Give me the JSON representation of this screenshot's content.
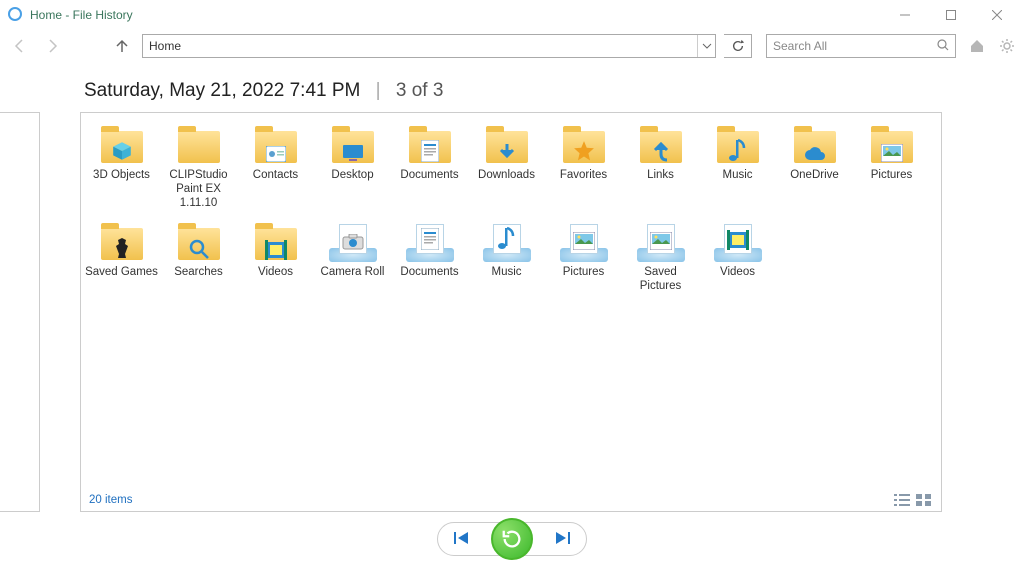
{
  "window": {
    "title": "Home - File History"
  },
  "nav": {
    "path": "Home",
    "search_placeholder": "Search All"
  },
  "header": {
    "timestamp": "Saturday, May 21, 2022 7:41 PM",
    "position": "3 of 3"
  },
  "items": [
    {
      "name": "3D Objects",
      "type": "folder",
      "overlay": "cube"
    },
    {
      "name": "CLIPStudio Paint EX 1.11.10",
      "type": "folder"
    },
    {
      "name": "Contacts",
      "type": "folder",
      "overlay": "card"
    },
    {
      "name": "Desktop",
      "type": "folder",
      "overlay": "desktop"
    },
    {
      "name": "Documents",
      "type": "folder",
      "overlay": "doc"
    },
    {
      "name": "Downloads",
      "type": "folder",
      "overlay": "down"
    },
    {
      "name": "Favorites",
      "type": "folder",
      "overlay": "star"
    },
    {
      "name": "Links",
      "type": "folder",
      "overlay": "link"
    },
    {
      "name": "Music",
      "type": "folder",
      "overlay": "note"
    },
    {
      "name": "OneDrive",
      "type": "folder",
      "overlay": "cloud"
    },
    {
      "name": "Pictures",
      "type": "folder",
      "overlay": "photo"
    },
    {
      "name": "Saved Games",
      "type": "folder",
      "overlay": "chess"
    },
    {
      "name": "Searches",
      "type": "folder",
      "overlay": "search"
    },
    {
      "name": "Videos",
      "type": "folder",
      "overlay": "film"
    },
    {
      "name": "Camera Roll",
      "type": "library",
      "overlay": "camera"
    },
    {
      "name": "Documents",
      "type": "library",
      "overlay": "doc"
    },
    {
      "name": "Music",
      "type": "library",
      "overlay": "note"
    },
    {
      "name": "Pictures",
      "type": "library",
      "overlay": "photo"
    },
    {
      "name": "Saved Pictures",
      "type": "library",
      "overlay": "photo"
    },
    {
      "name": "Videos",
      "type": "library",
      "overlay": "film"
    }
  ],
  "status": {
    "count": "20 items"
  }
}
